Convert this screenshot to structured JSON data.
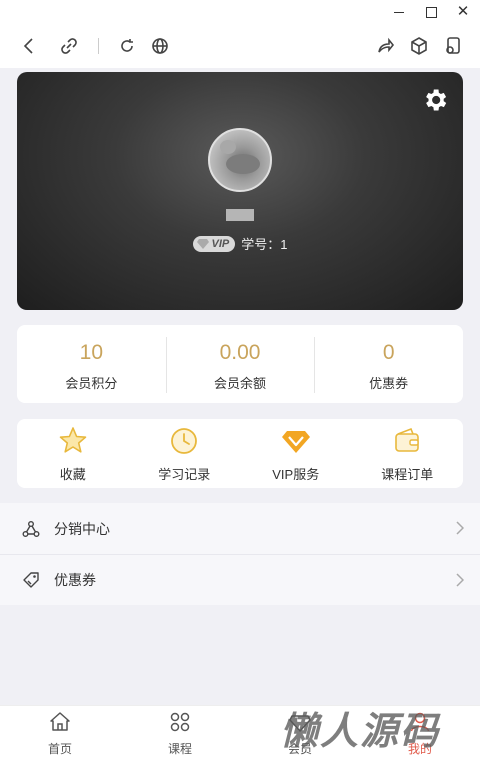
{
  "window": {
    "minimize_icon": "minimize-icon",
    "maximize_icon": "maximize-icon",
    "close_label": "✕"
  },
  "toolbar": {
    "icons": [
      "back-icon",
      "link-icon",
      "refresh-icon",
      "globe-icon",
      "share-icon",
      "cube-icon",
      "mini-app-icon"
    ]
  },
  "profile": {
    "username": "",
    "vip_badge": "VIP",
    "student_id": "学号：1"
  },
  "stats": [
    {
      "value": "10",
      "label": "会员积分"
    },
    {
      "value": "0.00",
      "label": "会员余额"
    },
    {
      "value": "0",
      "label": "优惠券"
    }
  ],
  "quick_menu": [
    {
      "label": "收藏",
      "icon": "star-icon"
    },
    {
      "label": "学习记录",
      "icon": "clock-icon"
    },
    {
      "label": "VIP服务",
      "icon": "vip-diamond-icon"
    },
    {
      "label": "课程订单",
      "icon": "wallet-icon"
    }
  ],
  "menu_list": [
    {
      "label": "分销中心",
      "icon": "distribution-icon"
    },
    {
      "label": "优惠券",
      "icon": "coupon-icon"
    }
  ],
  "tabbar": [
    {
      "label": "首页",
      "icon": "home-icon"
    },
    {
      "label": "课程",
      "icon": "grid-icon"
    },
    {
      "label": "会员",
      "icon": "vip-icon"
    },
    {
      "label": "我的",
      "icon": "user-icon"
    }
  ],
  "watermark": "懒人源码",
  "colors": {
    "accent_gold": "#c9a45c",
    "active_tab": "#e05a4a",
    "page_bg": "#f0f0f5"
  }
}
